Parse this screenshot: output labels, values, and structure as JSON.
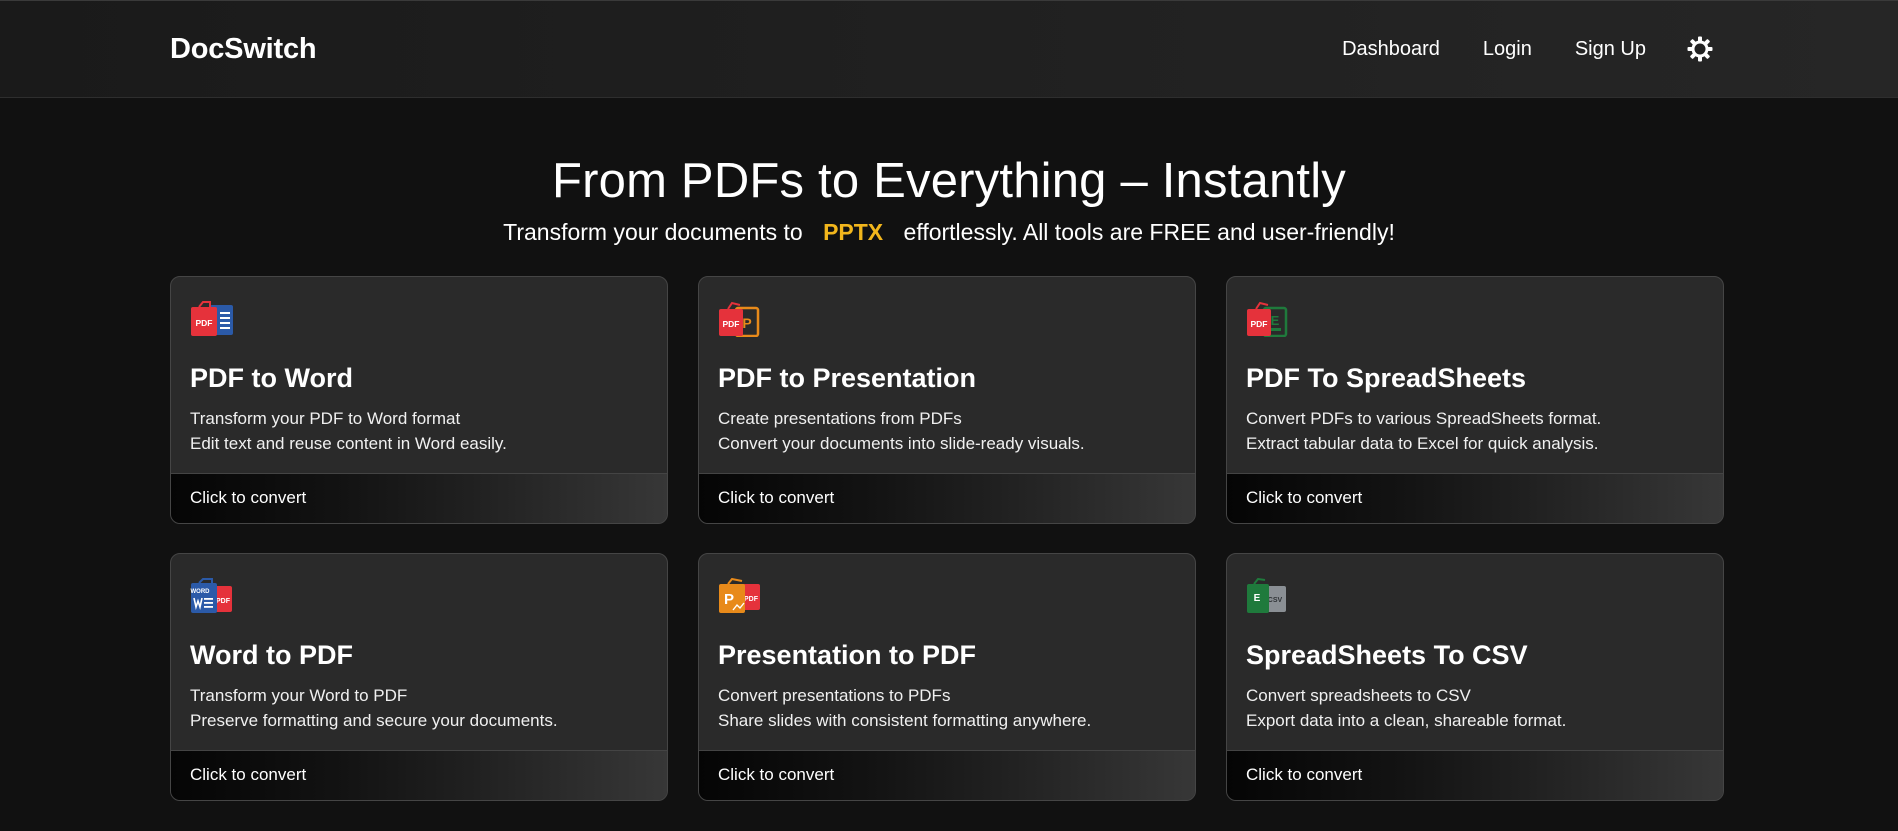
{
  "nav": {
    "brand": "DocSwitch",
    "links": [
      "Dashboard",
      "Login",
      "Sign Up"
    ],
    "theme_icon": "sun-icon"
  },
  "hero": {
    "title": "From PDFs to Everything – Instantly",
    "subtitle_before": "Transform your documents to",
    "accent_word": "PPTX",
    "subtitle_after": "effortlessly. All tools are FREE and user-friendly!",
    "accent_color": "#f2b61c"
  },
  "cards": [
    {
      "title": "PDF to Word",
      "line1": "Transform your PDF to Word format",
      "line2": "Edit text and reuse content in Word easily.",
      "footer": "Click to convert",
      "icon": "pdf-to-word-icon",
      "icon_text_a": "PDF",
      "icon_color_a": "#e5323b",
      "icon_color_b": "#2b5aa8"
    },
    {
      "title": "PDF to Presentation",
      "line1": "Create presentations from PDFs",
      "line2": "Convert your documents into slide-ready visuals.",
      "footer": "Click to convert",
      "icon": "pdf-to-presentation-icon",
      "icon_text_a": "PDF",
      "icon_text_b": "P",
      "icon_color_a": "#e5323b",
      "icon_color_b": "#e88a1a"
    },
    {
      "title": "PDF To SpreadSheets",
      "line1": "Convert PDFs to various SpreadSheets format.",
      "line2": "Extract tabular data to Excel for quick analysis.",
      "footer": "Click to convert",
      "icon": "pdf-to-spreadsheet-icon",
      "icon_text_a": "PDF",
      "icon_text_b": "E",
      "icon_color_a": "#e5323b",
      "icon_color_b": "#1f7a3c"
    },
    {
      "title": "Word to PDF",
      "line1": "Transform your Word to PDF",
      "line2": "Preserve formatting and secure your documents.",
      "footer": "Click to convert",
      "icon": "word-to-pdf-icon",
      "icon_text_a": "WORD",
      "icon_text_b": "PDF",
      "icon_color_a": "#2b5aa8",
      "icon_color_b": "#e5323b"
    },
    {
      "title": "Presentation to PDF",
      "line1": "Convert presentations to PDFs",
      "line2": "Share slides with consistent formatting anywhere.",
      "footer": "Click to convert",
      "icon": "presentation-to-pdf-icon",
      "icon_text_a": "P",
      "icon_text_b": "PDF",
      "icon_color_a": "#e88a1a",
      "icon_color_b": "#e5323b"
    },
    {
      "title": "SpreadSheets To CSV",
      "line1": "Convert spreadsheets to CSV",
      "line2": "Export data into a clean, shareable format.",
      "footer": "Click to convert",
      "icon": "spreadsheet-to-csv-icon",
      "icon_text_a": "E",
      "icon_text_b": "CSV",
      "icon_color_a": "#1f7a3c",
      "icon_color_b": "#8a8f94"
    }
  ]
}
